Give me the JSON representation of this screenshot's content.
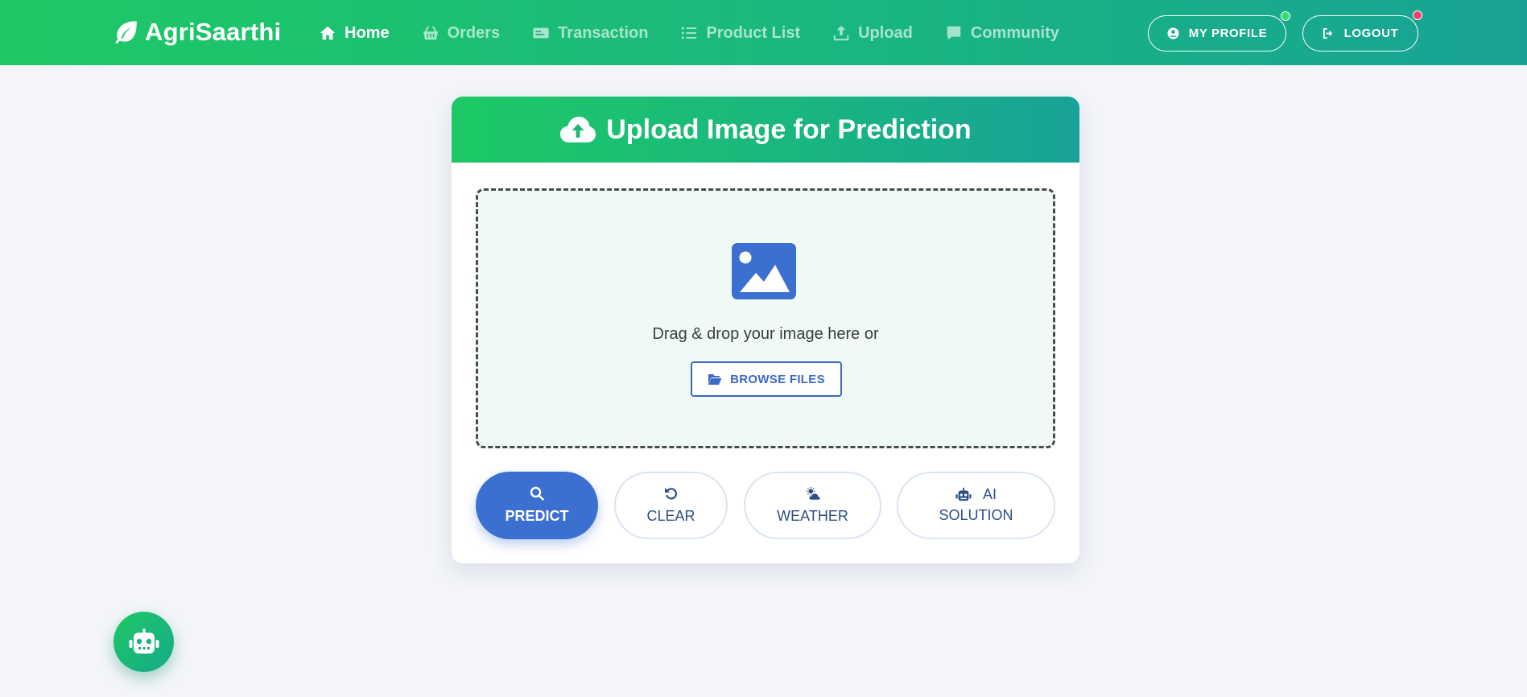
{
  "brand": {
    "name": "AgriSaarthi",
    "icon": "leaf-icon"
  },
  "nav": {
    "items": [
      {
        "label": "Home",
        "icon": "home-icon",
        "active": true
      },
      {
        "label": "Orders",
        "icon": "basket-icon",
        "active": false
      },
      {
        "label": "Transaction",
        "icon": "money-bill-icon",
        "active": false
      },
      {
        "label": "Product List",
        "icon": "list-icon",
        "active": false
      },
      {
        "label": "Upload",
        "icon": "upload-icon",
        "active": false
      },
      {
        "label": "Community",
        "icon": "comment-icon",
        "active": false
      }
    ]
  },
  "account": {
    "profile_label": "MY PROFILE",
    "logout_label": "LOGOUT",
    "online_status_color": "#2ee06b",
    "notification_color": "#f2426a"
  },
  "upload": {
    "title": "Upload Image for Prediction",
    "title_icon": "cloud-upload-icon",
    "dropzone_text": "Drag & drop your image here or",
    "browse_label": "BROWSE FILES",
    "placeholder_icon": "image-icon"
  },
  "actions": {
    "predict": "PREDICT",
    "clear": "CLEAR",
    "weather": "WEATHER",
    "ai_line1": "AI",
    "ai_line2": "SOLUTION"
  },
  "colors": {
    "brand_green": "#1ec964",
    "brand_teal": "#17a394",
    "primary_blue": "#3b6fd0",
    "page_background": "#f3f5f9"
  },
  "chatbot": {
    "icon": "robot-icon"
  }
}
